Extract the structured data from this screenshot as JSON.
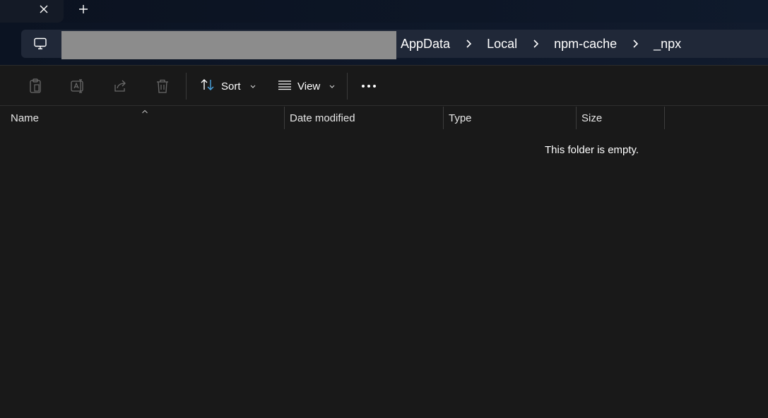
{
  "window": {
    "tab_close_icon": "close-icon",
    "new_tab_icon": "plus-icon"
  },
  "address_bar": {
    "pc_icon": "monitor-icon",
    "breadcrumbs": [
      "AppData",
      "Local",
      "npm-cache",
      "_npx"
    ],
    "separator_icon": "chevron-right-icon"
  },
  "toolbar": {
    "icons": [
      "paste-icon",
      "rename-icon",
      "share-icon",
      "delete-icon"
    ],
    "sort_label": "Sort",
    "view_label": "View",
    "more_icon": "ellipsis-icon"
  },
  "columns": [
    "Name",
    "Date modified",
    "Type",
    "Size"
  ],
  "sorted_column": "Name",
  "empty_message": "This folder is empty.",
  "colors": {
    "background": "#191919",
    "address_bg": "#202838",
    "text": "#ffffff",
    "accent_sort": "#4aa3df"
  }
}
